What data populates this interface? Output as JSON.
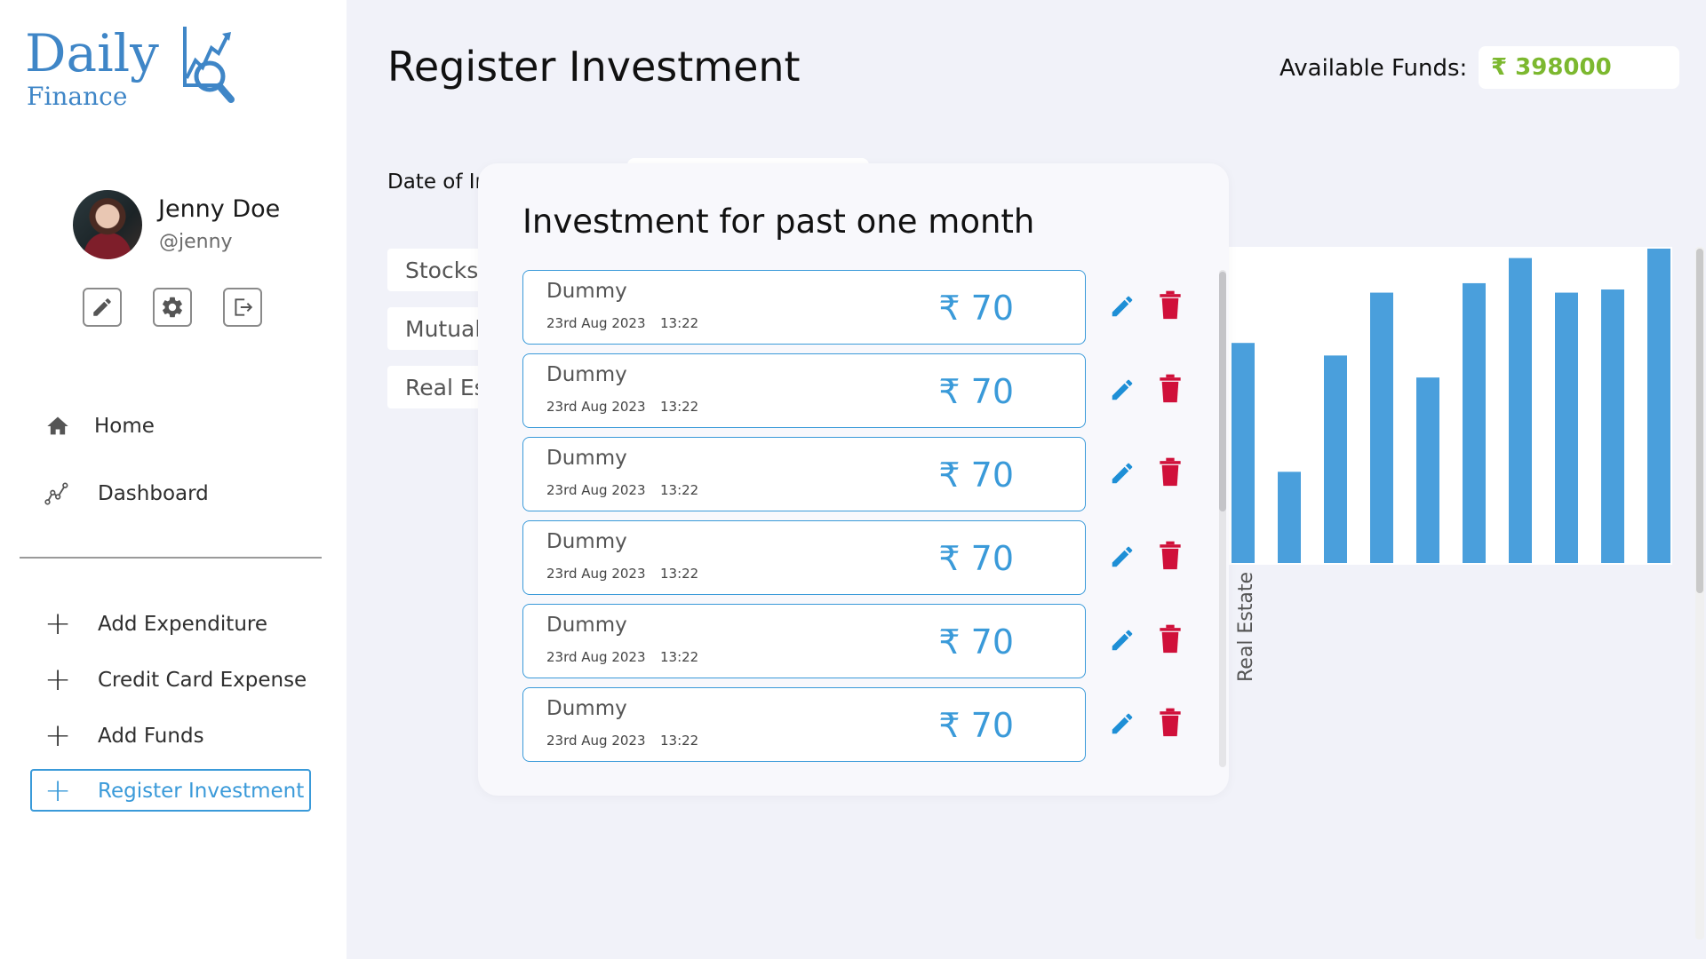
{
  "app": {
    "logo_main": "Daily",
    "logo_sub": "Finance"
  },
  "user": {
    "name": "Jenny Doe",
    "handle": "@jenny"
  },
  "profile_actions": [
    "pencil-icon",
    "gear-icon",
    "logout-icon"
  ],
  "nav": {
    "items": [
      {
        "label": "Home",
        "icon": "home-icon"
      },
      {
        "label": "Dashboard",
        "icon": "chart-line-icon"
      }
    ],
    "actions": [
      {
        "label": "Add Expenditure",
        "icon": "plus-icon"
      },
      {
        "label": "Credit Card Expense",
        "icon": "plus-icon"
      },
      {
        "label": "Add Funds",
        "icon": "plus-icon"
      },
      {
        "label": "Register Investment",
        "icon": "plus-icon",
        "active": true
      }
    ]
  },
  "header": {
    "title": "Register Investment",
    "funds_label": "Available Funds:",
    "funds_value": "₹ 398000"
  },
  "form": {
    "date_label": "Date of Ir",
    "categories": [
      "Stocks",
      "Mutual",
      "Real Es"
    ]
  },
  "popup": {
    "title": "Investment for past one month",
    "rows": [
      {
        "name": "Dummy",
        "date": "23rd Aug 2023",
        "time": "13:22",
        "amount": "₹ 70"
      },
      {
        "name": "Dummy",
        "date": "23rd Aug 2023",
        "time": "13:22",
        "amount": "₹ 70"
      },
      {
        "name": "Dummy",
        "date": "23rd Aug 2023",
        "time": "13:22",
        "amount": "₹ 70"
      },
      {
        "name": "Dummy",
        "date": "23rd Aug 2023",
        "time": "13:22",
        "amount": "₹ 70"
      },
      {
        "name": "Dummy",
        "date": "23rd Aug 2023",
        "time": "13:22",
        "amount": "₹ 70"
      },
      {
        "name": "Dummy",
        "date": "23rd Aug 2023",
        "time": "13:22",
        "amount": "₹ 70"
      }
    ]
  },
  "chart_data": {
    "type": "bar",
    "x_tick_labels": [
      "Real Estate"
    ],
    "values": [
      0.7,
      0.29,
      0.66,
      0.86,
      0.59,
      0.89,
      0.97,
      0.86,
      0.87,
      1.0
    ],
    "value_units": "fraction of the visible plot height",
    "color": "#4a9fdc"
  },
  "colors": {
    "accent": "#3a9ad9",
    "funds": "#7cb82f",
    "delete": "#d0103a",
    "brand": "#3f86c7"
  }
}
